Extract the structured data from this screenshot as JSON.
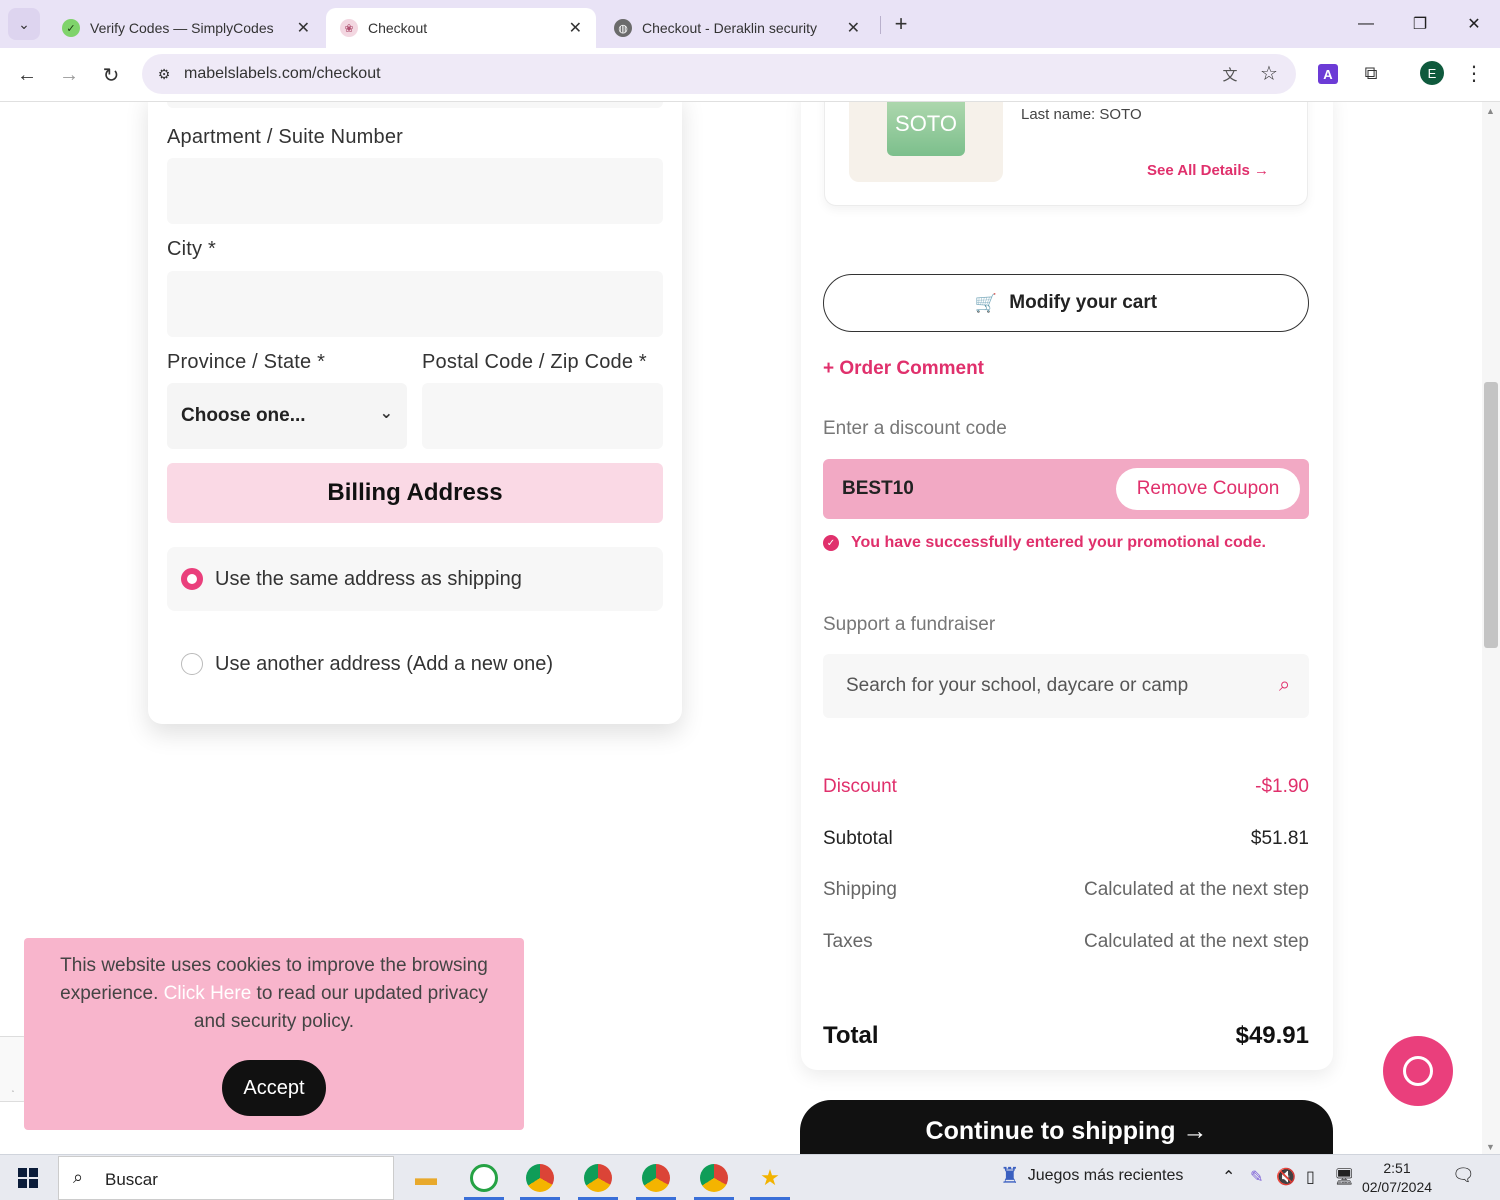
{
  "browser": {
    "tabs": [
      {
        "title": "Verify Codes — SimplyCodes",
        "active": false,
        "icon": "simplycodes-icon"
      },
      {
        "title": "Checkout",
        "active": true,
        "icon": "mabels-icon"
      },
      {
        "title": "Checkout - Deraklin security",
        "active": false,
        "icon": "globe-icon"
      }
    ],
    "url": "mabelslabels.com/checkout",
    "profile_initial": "E",
    "extension_letter": "A"
  },
  "form": {
    "apartment_label": "Apartment / Suite Number",
    "city_label": "City *",
    "province_label": "Province / State *",
    "postal_label": "Postal Code / Zip Code *",
    "province_value": "Choose one...",
    "billing_title": "Billing Address",
    "billing_options": [
      {
        "label": "Use the same address as shipping",
        "selected": true
      },
      {
        "label": "Use another address (Add a new one)",
        "selected": false
      }
    ]
  },
  "product": {
    "label_text": "SOTO",
    "last_name": "Last name: SOTO",
    "see_all": "See All Details →"
  },
  "summary": {
    "modify_cart": "Modify your cart",
    "order_comment": "+ Order Comment",
    "discount_label": "Enter a discount code",
    "coupon_code": "BEST10",
    "remove_coupon": "Remove Coupon",
    "success_msg": "You have successfully entered your promotional code.",
    "fundraiser_label": "Support a fundraiser",
    "fundraiser_placeholder": "Search for your school, daycare or camp",
    "rows": [
      {
        "label": "Discount",
        "value": "-$1.90"
      },
      {
        "label": "Subtotal",
        "value": "$51.81"
      },
      {
        "label": "Shipping",
        "value": "Calculated at the next step"
      },
      {
        "label": "Taxes",
        "value": "Calculated at the next step"
      }
    ],
    "total_label": "Total",
    "total_value": "$49.91",
    "continue": "Continue to shipping →"
  },
  "cookie": {
    "text_before": "This website uses cookies to improve the browsing experience. ",
    "link": "Click Here",
    "text_after": " to read our updated privacy and security policy.",
    "accept": "Accept"
  },
  "taskbar": {
    "search_placeholder": "Buscar",
    "games_label": "Juegos más recientes",
    "time": "2:51",
    "date": "02/07/2024"
  },
  "colors": {
    "accent": "#e0306c",
    "coupon_bg": "#f2a9c4",
    "billing_bg": "#fad9e5",
    "cookie_bg": "#f8b5cc"
  }
}
